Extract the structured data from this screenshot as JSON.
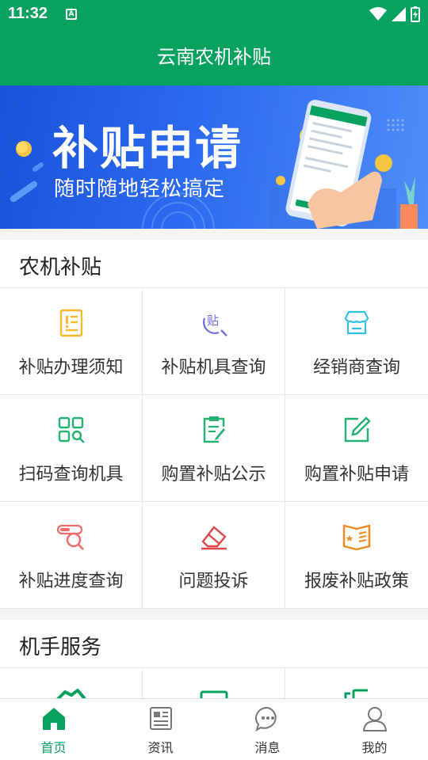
{
  "status": {
    "time": "11:32",
    "notification_letter": "A"
  },
  "app": {
    "title": "云南农机补贴"
  },
  "banner": {
    "title": "补贴申请",
    "subtitle": "随时随地轻松搞定"
  },
  "sections": [
    {
      "title": "农机补贴",
      "items": [
        {
          "label": "补贴办理须知",
          "icon": "notice-document-icon",
          "color": "#f5b82e"
        },
        {
          "label": "补贴机具查询",
          "icon": "subsidy-search-icon",
          "color": "#6b6fe0"
        },
        {
          "label": "经销商查询",
          "icon": "store-icon",
          "color": "#2ec1e0"
        },
        {
          "label": "扫码查询机具",
          "icon": "scan-grid-icon",
          "color": "#23b26f"
        },
        {
          "label": "购置补贴公示",
          "icon": "clipboard-edit-icon",
          "color": "#23b26f"
        },
        {
          "label": "购置补贴申请",
          "icon": "edit-square-icon",
          "color": "#23b26f"
        },
        {
          "label": "补贴进度查询",
          "icon": "progress-search-icon",
          "color": "#f06a6a"
        },
        {
          "label": "问题投诉",
          "icon": "eraser-icon",
          "color": "#e04848"
        },
        {
          "label": "报废补贴政策",
          "icon": "policy-book-icon",
          "color": "#f08a1c"
        }
      ]
    },
    {
      "title": "机手服务"
    }
  ],
  "tabs": [
    {
      "label": "首页",
      "icon": "home-icon",
      "active": true
    },
    {
      "label": "资讯",
      "icon": "news-icon",
      "active": false
    },
    {
      "label": "消息",
      "icon": "message-icon",
      "active": false
    },
    {
      "label": "我的",
      "icon": "user-icon",
      "active": false
    }
  ],
  "colors": {
    "primary": "#08a25f",
    "banner": "#2c6af0"
  }
}
